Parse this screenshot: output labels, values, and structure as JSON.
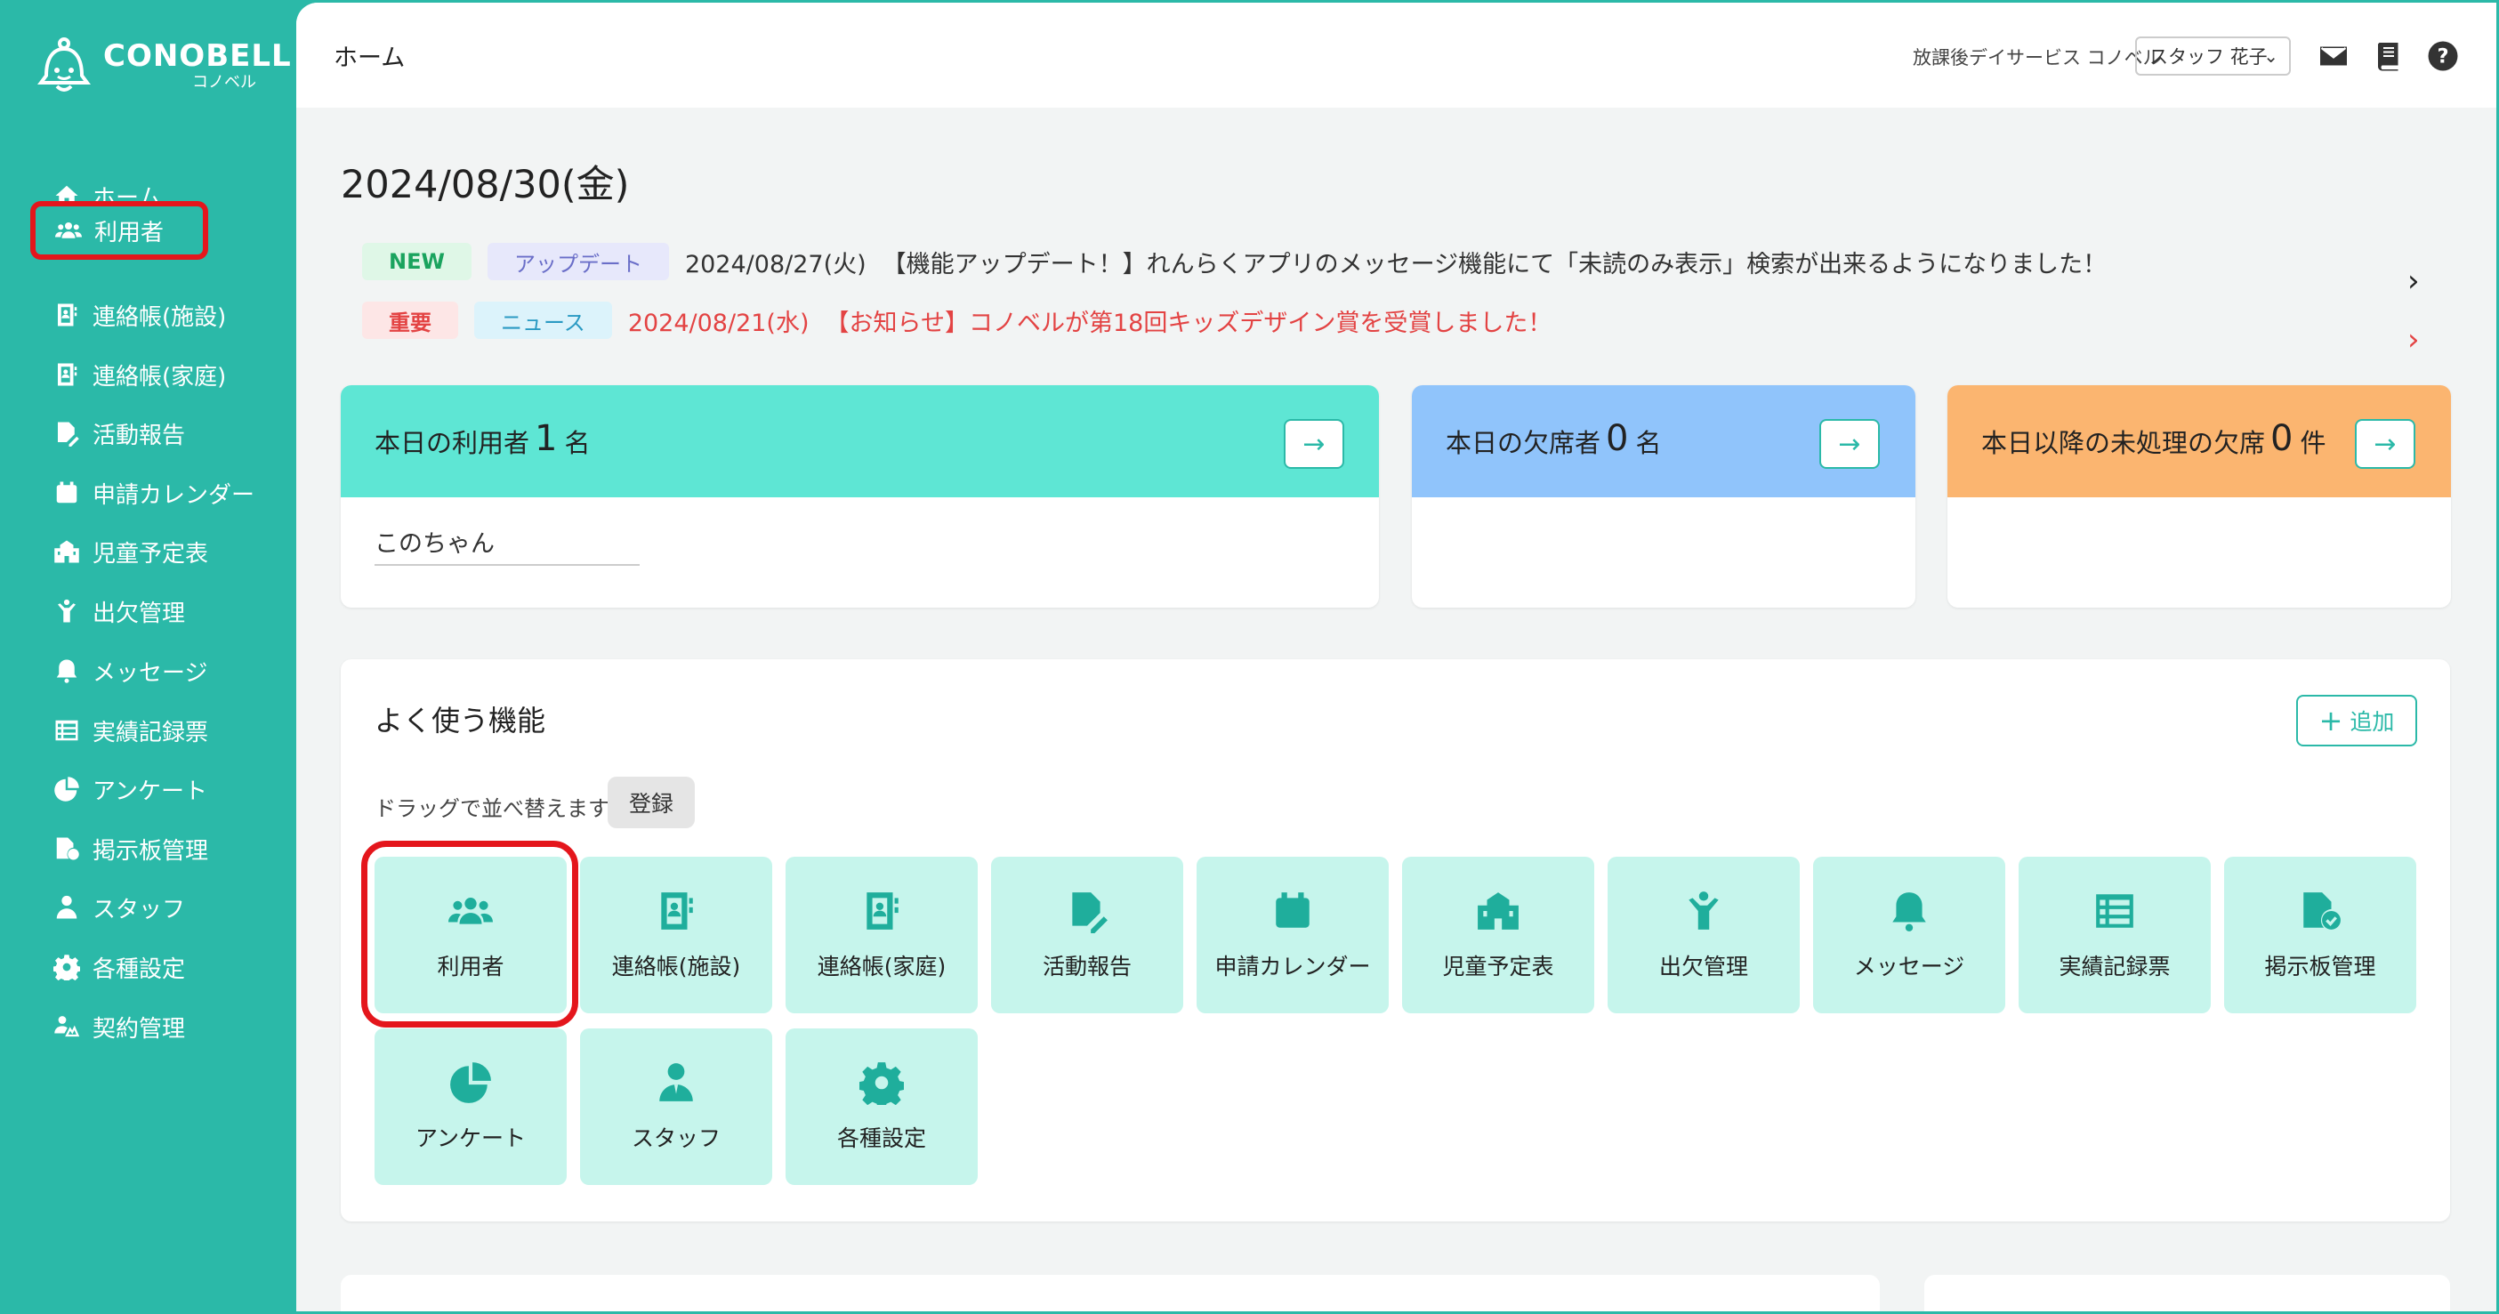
{
  "app": {
    "logo_text": "CONOBELL",
    "logo_sub": "コノベル"
  },
  "sidebar": {
    "items": [
      {
        "label": "ホーム",
        "icon": "home-icon"
      },
      {
        "label": "利用者",
        "icon": "users-icon",
        "highlighted": true
      },
      {
        "label": "連絡帳(施設)",
        "icon": "contact-book-icon"
      },
      {
        "label": "連絡帳(家庭)",
        "icon": "contact-book-icon"
      },
      {
        "label": "活動報告",
        "icon": "report-edit-icon"
      },
      {
        "label": "申請カレンダー",
        "icon": "calendar-icon"
      },
      {
        "label": "児童予定表",
        "icon": "school-icon"
      },
      {
        "label": "出欠管理",
        "icon": "child-icon"
      },
      {
        "label": "メッセージ",
        "icon": "bell-icon"
      },
      {
        "label": "実績記録票",
        "icon": "list-icon"
      },
      {
        "label": "アンケート",
        "icon": "pie-icon"
      },
      {
        "label": "掲示板管理",
        "icon": "board-icon"
      },
      {
        "label": "スタッフ",
        "icon": "staff-icon"
      },
      {
        "label": "各種設定",
        "icon": "gear-icon"
      },
      {
        "label": "契約管理",
        "icon": "contract-icon"
      }
    ]
  },
  "header": {
    "title": "ホーム",
    "facility": "放課後デイサービス コノベル",
    "staff_select": "スタッフ 花子"
  },
  "date": "2024/08/30(金)",
  "news": [
    {
      "badge1": "NEW",
      "badge2": "アップデート",
      "date": "2024/08/27(火)",
      "text": "【機能アップデート！】れんらくアプリのメッセージ機能にて「未読のみ表示」検索が出来るようになりました！"
    },
    {
      "badge1": "重要",
      "badge2": "ニュース",
      "date": "2024/08/21(水)",
      "text": "【お知らせ】コノベルが第18回キッズデザイン賞を受賞しました！"
    }
  ],
  "cards": [
    {
      "label": "本日の利用者",
      "count": "1",
      "unit": "名",
      "color": "#5ee6d4",
      "users": [
        "このちゃん"
      ]
    },
    {
      "label": "本日の欠席者",
      "count": "0",
      "unit": "名",
      "color": "#90c4fb"
    },
    {
      "label": "本日以降の未処理の欠席",
      "count": "0",
      "unit": "件",
      "color": "#fbb570"
    }
  ],
  "favorites": {
    "title": "よく使う機能",
    "add_label": "追加",
    "drag_hint": "ドラッグで並べ替えます。",
    "register_label": "登録",
    "tiles": [
      {
        "label": "利用者",
        "icon": "users-icon"
      },
      {
        "label": "連絡帳(施設)",
        "icon": "contact-book-icon"
      },
      {
        "label": "連絡帳(家庭)",
        "icon": "contact-book-icon"
      },
      {
        "label": "活動報告",
        "icon": "report-edit-icon"
      },
      {
        "label": "申請カレンダー",
        "icon": "calendar-icon"
      },
      {
        "label": "児童予定表",
        "icon": "school-icon"
      },
      {
        "label": "出欠管理",
        "icon": "child-icon"
      },
      {
        "label": "メッセージ",
        "icon": "bell-icon"
      },
      {
        "label": "実績記録票",
        "icon": "list-icon"
      },
      {
        "label": "掲示板管理",
        "icon": "board-check-icon"
      },
      {
        "label": "アンケート",
        "icon": "pie-icon"
      },
      {
        "label": "スタッフ",
        "icon": "staff-icon"
      },
      {
        "label": "各種設定",
        "icon": "gear-icon"
      }
    ]
  },
  "colors": {
    "brand": "#2bb9a8",
    "highlight": "#e4161c",
    "tile_bg": "#c6f5ec"
  }
}
